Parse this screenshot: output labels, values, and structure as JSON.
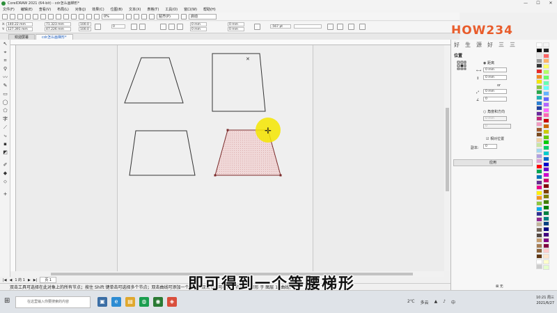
{
  "window": {
    "title": "CorelDRAW 2021 (64-bit) - cdr怎么画梯形*",
    "controls": [
      "—",
      "☐",
      "✕"
    ]
  },
  "menu": [
    "文件(F)",
    "编辑(E)",
    "查看(V)",
    "布局(L)",
    "对象(J)",
    "效果(C)",
    "位图(B)",
    "文本(X)",
    "表格(T)",
    "工具(O)",
    "窗口(W)",
    "帮助(H)"
  ],
  "toolbar": {
    "zoom": "0%",
    "snap_label": "贴齐(P)",
    "launch_label": "启动"
  },
  "propbar": {
    "x": "140.22 mm",
    "y": "127.391 mm",
    "w": "71.323 mm",
    "h": "47.226 mm",
    "sx": "100.0",
    "sy": "100.0",
    "angle": "0",
    "nudge1": "0 mm",
    "nudge2": "0 mm",
    "nudge3": "0 mm",
    "nudge4": "0 mm",
    "outline": ".567 pt"
  },
  "tabs": [
    {
      "label": "欢迎屏幕",
      "active": false
    },
    {
      "label": "cdr怎么画梯形*",
      "active": true
    }
  ],
  "logo": {
    "text": "HOW234",
    "colors": [
      "#e85c2b",
      "#f2a51c",
      "#6cbb3c",
      "#e85c2b",
      "#3d9be0",
      "#f2a51c"
    ]
  },
  "docker": {
    "tabs": [
      "好",
      "生",
      "源",
      "好",
      "三",
      "三"
    ],
    "title": "位置",
    "distance_label": "距离",
    "x_val": "0 mm",
    "y_val": "0 mm",
    "or_label": "or",
    "dist_val": "0 mm",
    "dist_angle": "0",
    "angle_dir_label": "角度和方向",
    "angle_val": "0 mm",
    "angle_dir_val": "0",
    "relative_label": "相对位置",
    "copies_label": "副本:",
    "copies_val": "0",
    "apply_label": "应用"
  },
  "page_nav": {
    "count": "1 的 1",
    "page_label": "页 1"
  },
  "status": {
    "hint": "双击工具可选择在此对象上的所有节点；按住 Shift 键单击可选择多个节点；双击曲线可添加一个节点；双击节点可移除该节点",
    "layer": "矩形 于 图层 1 (曲线)",
    "fill": "无"
  },
  "subtitle": "即可得到一个等腰梯形",
  "taskbar": {
    "search_placeholder": "在这里输入你要搜索的内容",
    "temp": "2℃",
    "weather": "多云",
    "ime": "中",
    "time": "10:21 周三",
    "date": "2021/6/27"
  },
  "colors": {
    "accent": "#2060c0",
    "selection_fill": "#f0d8d8",
    "cursor_highlight": "#f5e600"
  }
}
